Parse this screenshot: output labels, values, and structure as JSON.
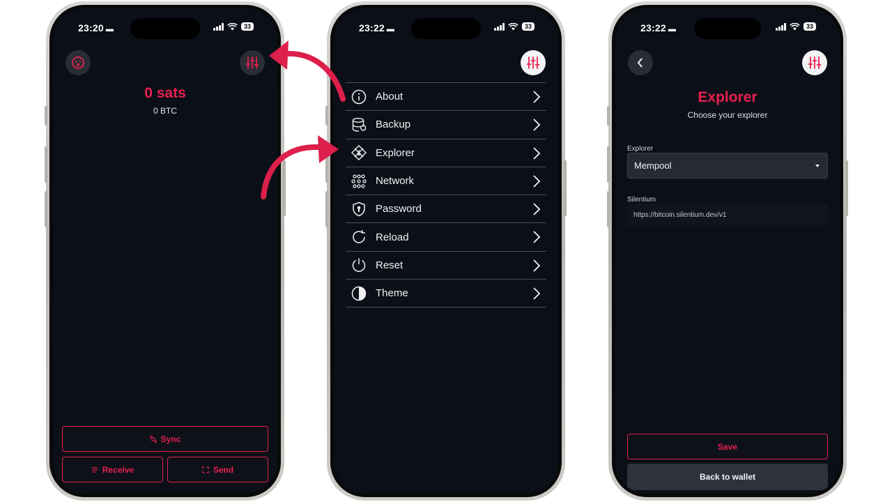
{
  "colors": {
    "accent": "#e8204f",
    "screen_bg": "#0b0f17",
    "divider": "#4a4e57"
  },
  "phone1": {
    "status": {
      "time": "23:20",
      "battery": "33"
    },
    "balance_sats": "0 sats",
    "balance_btc": "0 BTC",
    "buttons": {
      "sync": "Sync",
      "receive": "Receive",
      "send": "Send"
    }
  },
  "phone2": {
    "status": {
      "time": "23:22",
      "battery": "33"
    },
    "menu": [
      {
        "label": "About",
        "icon": "info-icon"
      },
      {
        "label": "Backup",
        "icon": "database-icon"
      },
      {
        "label": "Explorer",
        "icon": "explorer-icon"
      },
      {
        "label": "Network",
        "icon": "network-icon"
      },
      {
        "label": "Password",
        "icon": "shield-lock-icon"
      },
      {
        "label": "Reload",
        "icon": "reload-icon"
      },
      {
        "label": "Reset",
        "icon": "power-icon"
      },
      {
        "label": "Theme",
        "icon": "theme-icon"
      }
    ]
  },
  "phone3": {
    "status": {
      "time": "23:22",
      "battery": "33"
    },
    "title": "Explorer",
    "subtitle": "Choose your explorer",
    "explorer_label": "Explorer",
    "explorer_value": "Mempool",
    "silentium_label": "Silentium",
    "silentium_value": "https://bitcoin.silentium.dev/v1",
    "save_label": "Save",
    "back_label": "Back to wallet"
  }
}
